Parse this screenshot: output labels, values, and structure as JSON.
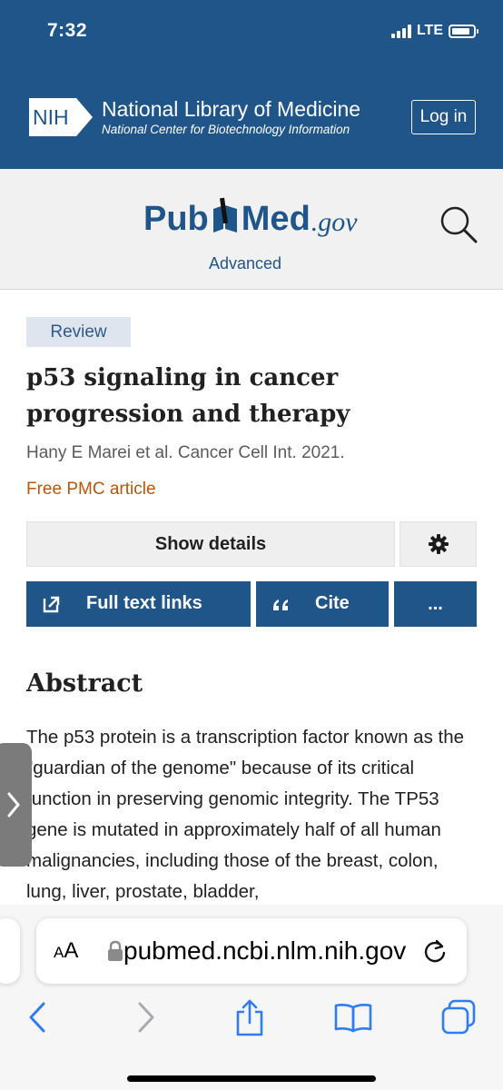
{
  "status_bar": {
    "time": "7:32",
    "network": "LTE"
  },
  "nih_header": {
    "logo_text": "NIH",
    "title": "National Library of Medicine",
    "subtitle": "National Center for Biotechnology Information",
    "login_label": "Log in"
  },
  "pubmed": {
    "logo_left": "Pub",
    "logo_right": "Med",
    "logo_suffix": ".gov",
    "advanced_label": "Advanced"
  },
  "article": {
    "badge": "Review",
    "title": "p53 signaling in cancer progression and therapy",
    "authors": "Hany E Marei et al. Cancer Cell Int. 2021.",
    "free_pmc": "Free PMC article"
  },
  "actions": {
    "show_details": "Show details",
    "full_text_links": "Full text links",
    "cite": "Cite",
    "more": "..."
  },
  "abstract": {
    "heading": "Abstract",
    "text": "The p53 protein is a transcription factor known as the \"guardian of the genome\" because of its critical function in preserving genomic integrity. The TP53 gene is mutated in approximately half of all human malignancies, including those of the breast, colon, lung, liver, prostate, bladder,"
  },
  "browser": {
    "reader_label_small": "A",
    "reader_label_large": "A",
    "url": "pubmed.ncbi.nlm.nih.gov"
  },
  "colors": {
    "nih_blue": "#20558a",
    "free_pmc_orange": "#b3570b",
    "badge_bg": "#dfe5ee",
    "ios_blue": "#2f7cf6"
  },
  "icons": [
    "nih-logo",
    "pubmed-book-icon",
    "search-icon",
    "gear-icon",
    "external-link-icon",
    "quote-icon",
    "chevron-right-icon",
    "lock-icon",
    "reload-icon",
    "back-icon",
    "forward-icon",
    "share-icon",
    "bookmarks-icon",
    "tabs-icon"
  ]
}
